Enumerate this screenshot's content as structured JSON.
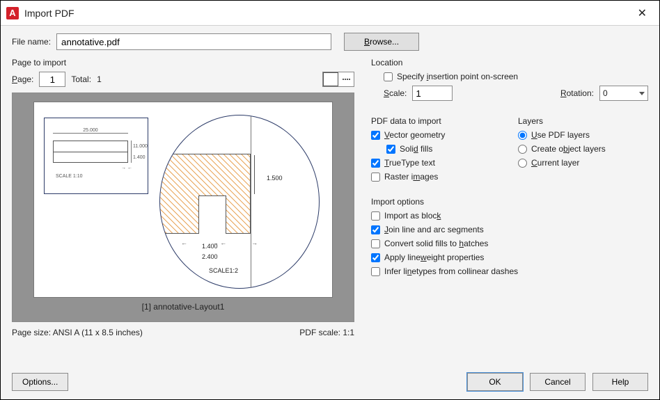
{
  "window": {
    "title": "Import PDF"
  },
  "file": {
    "label": "File name:",
    "value": "annotative.pdf",
    "browse": "Browse..."
  },
  "page_section": {
    "heading": "Page to import",
    "page_label": "Page:",
    "page_value": "1",
    "total_label": "Total:",
    "total_value": "1",
    "caption": "[1] annotative-Layout1",
    "size_label": "Page size:",
    "size_value": "ANSI A (11 x 8.5 inches)",
    "scale_label": "PDF scale:",
    "scale_value": "1:1"
  },
  "preview_dims": {
    "top": "25.000",
    "right_top": "11.000",
    "right_bottom": "1.400",
    "mini_scale": "SCALE 1:10",
    "d1": "1.500",
    "d2": "1.400",
    "d3": "2.400",
    "d4": "SCALE1:2"
  },
  "location": {
    "heading": "Location",
    "specify": "Specify insertion point on-screen",
    "scale_label": "Scale:",
    "scale_value": "1",
    "rotation_label": "Rotation:",
    "rotation_value": "0"
  },
  "pdf_data": {
    "heading": "PDF data to import",
    "vector": "Vector geometry",
    "solid": "Solid fills",
    "truetype": "TrueType text",
    "raster": "Raster images"
  },
  "layers": {
    "heading": "Layers",
    "use": "Use PDF layers",
    "create": "Create object layers",
    "current": "Current layer"
  },
  "import_opts": {
    "heading": "Import options",
    "block": "Import as block",
    "join": "Join line and arc segments",
    "convert": "Convert solid fills to hatches",
    "lineweight": "Apply lineweight properties",
    "infer": "Infer linetypes from collinear dashes"
  },
  "footer": {
    "options": "Options...",
    "ok": "OK",
    "cancel": "Cancel",
    "help": "Help"
  }
}
